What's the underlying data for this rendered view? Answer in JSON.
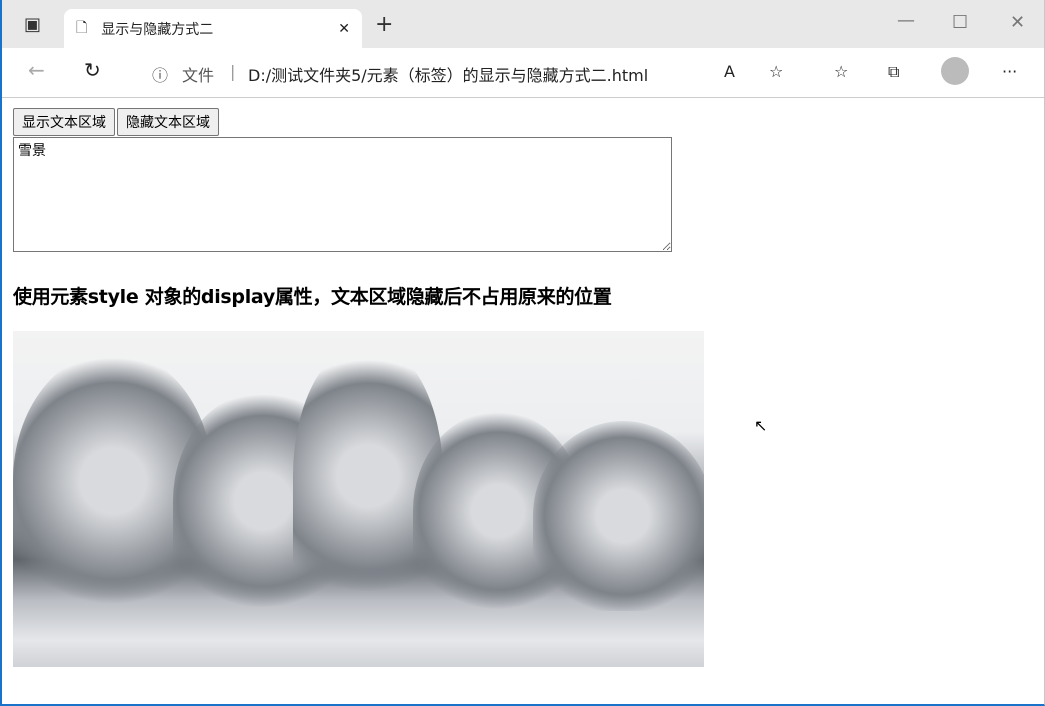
{
  "browser": {
    "tab_title": "显示与隐藏方式二",
    "file_label": "文件",
    "url": "D:/测试文件夹5/元素（标签）的显示与隐藏方式二.html"
  },
  "page": {
    "show_button": "显示文本区域",
    "hide_button": "隐藏文本区域",
    "textarea_value": "雪景",
    "heading": "使用元素style 对象的display属性，文本区域隐藏后不占用原来的位置"
  }
}
